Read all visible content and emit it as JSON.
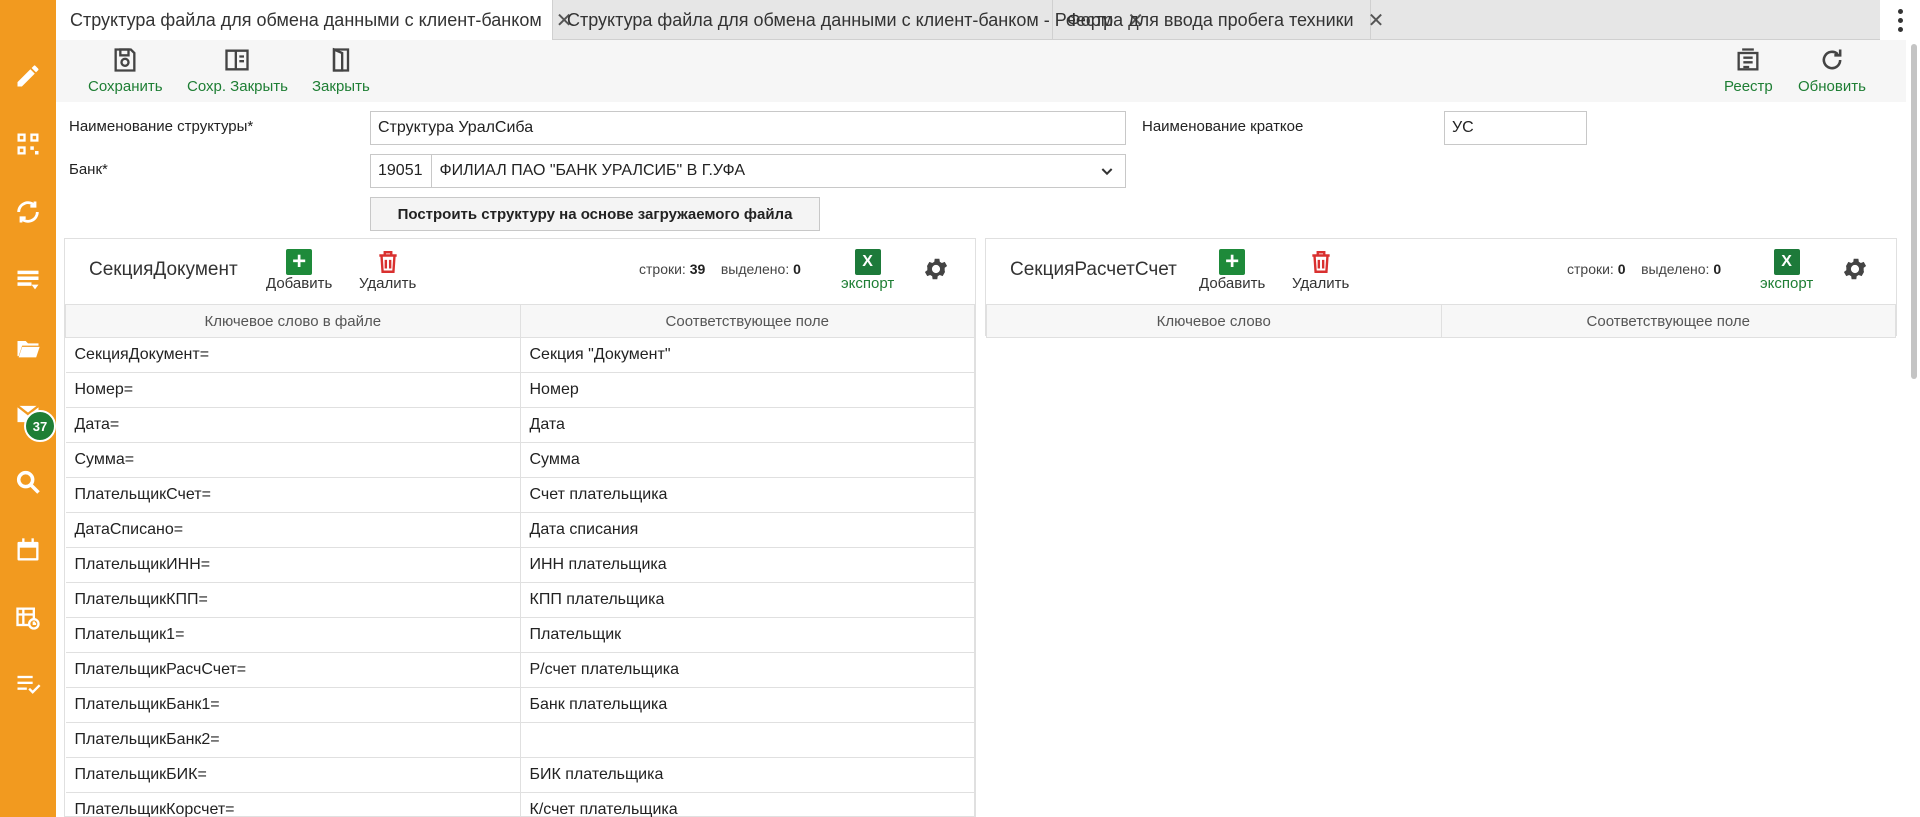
{
  "tabs": [
    {
      "label": "Структура файла для обмена данными с клиент-банком",
      "active": true
    },
    {
      "label": "Структура файла для обмена данными с клиент-банком - Реестр",
      "active": false
    },
    {
      "label": "Форма для ввода пробега техники",
      "active": false
    }
  ],
  "sidebar": {
    "mail_badge": "37"
  },
  "toolbar": {
    "save": "Сохранить",
    "save_close": "Сохр. Закрыть",
    "close": "Закрыть",
    "registry": "Реестр",
    "refresh": "Обновить"
  },
  "form": {
    "name_label": "Наименование структуры*",
    "name_value": "Структура УралСиба",
    "short_label": "Наименование краткое",
    "short_value": "УС",
    "bank_label": "Банк*",
    "bank_code": "19051",
    "bank_name": "ФИЛИАЛ ПАО \"БАНК УРАЛСИБ\" В Г.УФА",
    "build_button": "Построить структуру на основе загружаемого файла"
  },
  "left_panel": {
    "title": "СекцияДокумент",
    "add": "Добавить",
    "delete": "Удалить",
    "rows_label": "строки:",
    "rows_count": "39",
    "selected_label": "выделено:",
    "selected_count": "0",
    "export": "экспорт",
    "columns": [
      "Ключевое слово в файле",
      "Соответствующее поле"
    ],
    "rows": [
      [
        "СекцияДокумент=",
        "Секция \"Документ\""
      ],
      [
        "Номер=",
        "Номер"
      ],
      [
        "Дата=",
        "Дата"
      ],
      [
        "Сумма=",
        "Сумма"
      ],
      [
        "ПлательщикСчет=",
        "Счет плательщика"
      ],
      [
        "ДатаСписано=",
        "Дата списания"
      ],
      [
        "ПлательщикИНН=",
        "ИНН плательщика"
      ],
      [
        "ПлательщикКПП=",
        "КПП плательщика"
      ],
      [
        "Плательщик1=",
        "Плательщик"
      ],
      [
        "ПлательщикРасчСчет=",
        "Р/счет плательщика"
      ],
      [
        "ПлательщикБанк1=",
        "Банк плательщика"
      ],
      [
        "ПлательщикБанк2=",
        ""
      ],
      [
        "ПлательщикБИК=",
        "БИК плательщика"
      ],
      [
        "ПлательщикКорсчет=",
        "К/счет плательщика"
      ]
    ]
  },
  "right_panel": {
    "title": "СекцияРасчетСчет",
    "add": "Добавить",
    "delete": "Удалить",
    "rows_label": "строки:",
    "rows_count": "0",
    "selected_label": "выделено:",
    "selected_count": "0",
    "export": "экспорт",
    "columns": [
      "Ключевое слово",
      "Соответствующее поле"
    ]
  },
  "icons": {
    "xls_letter": "X"
  },
  "colors": {
    "sidebar": "#f29a1f",
    "accent_green": "#1e7e34",
    "delete_red": "#d9302f"
  }
}
